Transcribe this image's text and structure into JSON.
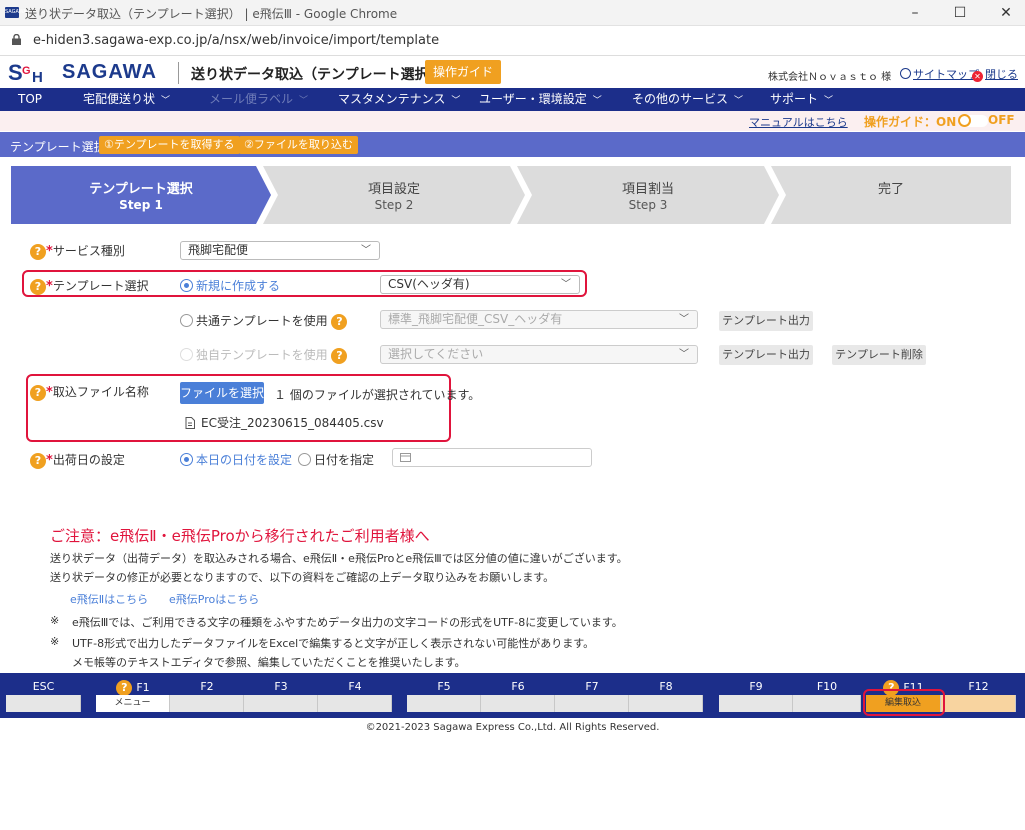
{
  "window": {
    "title": "送り状データ取込（テンプレート選択） | e飛伝Ⅲ - Google Chrome"
  },
  "browser": {
    "url": "e-hiden3.sagawa-exp.co.jp/a/nsx/web/invoice/import/template"
  },
  "header": {
    "logo_mark": "SGH",
    "brand": "SAGAWA",
    "page_title": "送り状データ取込（テンプレート選択）",
    "guide_button": "操作ガイド",
    "company": "株式会社Ｎｏｖａｓｔｏ 様",
    "sitemap": "サイトマップ",
    "close": "閉じる"
  },
  "nav": [
    {
      "label": "TOP"
    },
    {
      "label": "宅配便送り状"
    },
    {
      "label": "メール便ラベル"
    },
    {
      "label": "マスタメンテナンス"
    },
    {
      "label": "ユーザー・環境設定"
    },
    {
      "label": "その他のサービス"
    },
    {
      "label": "サポート"
    }
  ],
  "subbar": {
    "manual": "マニュアルはこちら",
    "guide_on": "操作ガイド：ON",
    "guide_off": "OFF"
  },
  "breadcrumb": {
    "current": "テンプレート選択",
    "btn1": "①テンプレートを取得する",
    "btn2": "②ファイルを取り込む"
  },
  "steps": [
    {
      "title": "テンプレート選択",
      "num": "Step 1"
    },
    {
      "title": "項目設定",
      "num": "Step 2"
    },
    {
      "title": "項目割当",
      "num": "Step 3"
    },
    {
      "title": "完了",
      "num": ""
    }
  ],
  "form": {
    "service_label": "サービス種別",
    "service_value": "飛脚宅配便",
    "template_label": "テンプレート選択",
    "radio_new": "新規に作成する",
    "new_format": "CSV(ヘッダ有)",
    "radio_common": "共通テンプレートを使用",
    "common_value": "標準_飛脚宅配便_CSV_ヘッダ有",
    "radio_own": "独自テンプレートを使用",
    "own_placeholder": "選択してください",
    "template_output": "テンプレート出力",
    "template_delete": "テンプレート削除",
    "file_label": "取込ファイル名称",
    "file_button": "ファイルを選択",
    "file_status": "１ 個のファイルが選択されています。",
    "file_name": "EC受注_20230615_084405.csv",
    "ship_label": "出荷日の設定",
    "ship_today": "本日の日付を設定",
    "ship_specify": "日付を指定",
    "help": "?",
    "required": "*"
  },
  "notice": {
    "heading": "ご注意：e飛伝Ⅱ・e飛伝Proから移行されたご利用者様へ",
    "line1": "送り状データ（出荷データ）を取込みされる場合、e飛伝Ⅱ・e飛伝Proとe飛伝Ⅲでは区分値の値に違いがございます。",
    "line2": "送り状データの修正が必要となりますので、以下の資料をご確認の上データ取り込みをお願いします。",
    "link1": "e飛伝Ⅱはこちら",
    "link2": "e飛伝Proはこちら",
    "mark": "※",
    "note1": "e飛伝Ⅲでは、ご利用できる文字の種類をふやすためデータ出力の文字コードの形式をUTF-8に変更しています。",
    "note2": "UTF-8形式で出力したデータファイルをExcelで編集すると文字が正しく表示されない可能性があります。",
    "note3": "メモ帳等のテキストエディタで参照、編集していただくことを推奨いたします。"
  },
  "fkeys": {
    "esc": "ESC",
    "f1": "F1",
    "f2": "F2",
    "f3": "F3",
    "f4": "F4",
    "f5": "F5",
    "f6": "F6",
    "f7": "F7",
    "f8": "F8",
    "f9": "F9",
    "f10": "F10",
    "f11": "F11",
    "f12": "F12",
    "f1_action": "メニュー",
    "f11_action": "編集取込"
  },
  "footer": "©2021-2023 Sagawa Express Co.,Ltd. All Rights Reserved.",
  "colors": {
    "navy": "#1c2e8a",
    "accent": "#f0a020",
    "required": "#e0143c",
    "link": "#4a7fd8",
    "step_active": "#5b6ac9"
  }
}
